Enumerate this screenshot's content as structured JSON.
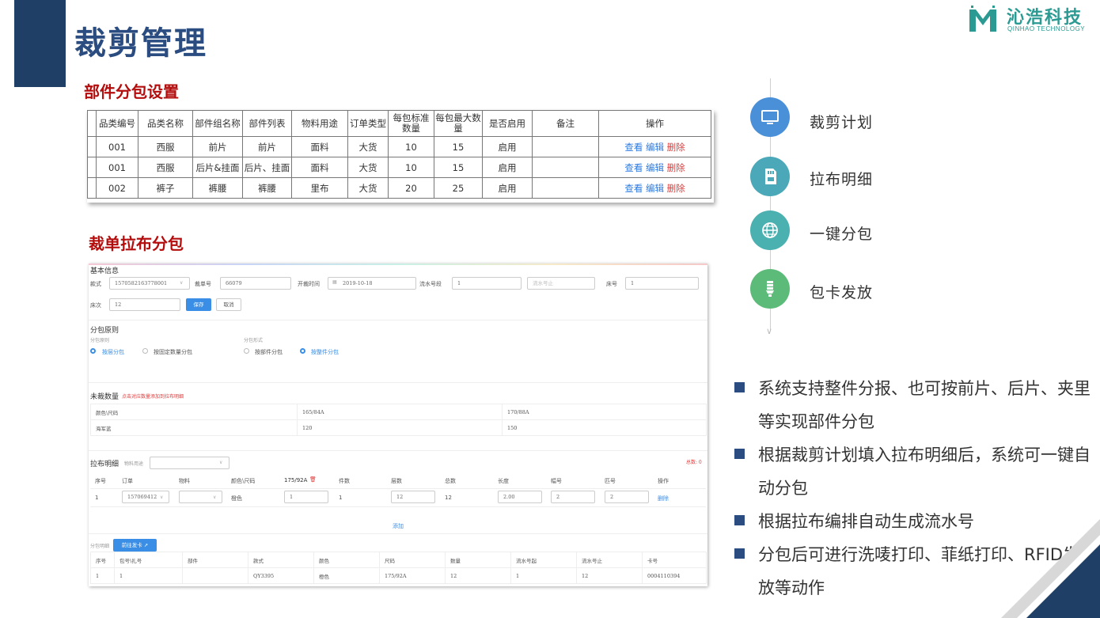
{
  "title": "裁剪管理",
  "logo": {
    "name": "沁浩科技",
    "sub": "QINHAO TECHNOLOGY"
  },
  "section1": {
    "title": "部件分包设置",
    "headers": [
      "品类编号",
      "品类名称",
      "部件组名称",
      "部件列表",
      "物料用途",
      "订单类型",
      "每包标准数量",
      "每包最大数量",
      "是否启用",
      "备注",
      "操作"
    ],
    "rows": [
      [
        "001",
        "西服",
        "前片",
        "前片",
        "面料",
        "大货",
        "10",
        "15",
        "启用",
        ""
      ],
      [
        "001",
        "西服",
        "后片&挂面",
        "后片、挂面",
        "面料",
        "大货",
        "10",
        "15",
        "启用",
        ""
      ],
      [
        "002",
        "裤子",
        "裤腰",
        "裤腰",
        "里布",
        "大货",
        "20",
        "25",
        "启用",
        ""
      ]
    ],
    "actions": {
      "view": "查看",
      "edit": "编辑",
      "delete": "删除"
    }
  },
  "section2": {
    "title": "裁单拉布分包",
    "basic": {
      "heading": "基本信息",
      "style_label": "款式",
      "style_value": "1570582163778001",
      "cut_no_label": "裁单号",
      "cut_no_value": "66079",
      "start_label": "开裁时间",
      "start_value": "2019-10-18",
      "serial_label": "流水号段",
      "serial_from": "1",
      "serial_to_placeholder": "流水号止",
      "bed_no_label": "床号",
      "bed_no_value": "1",
      "bed_times_label": "床次",
      "bed_times_value": "12",
      "save": "保存",
      "cancel": "取消"
    },
    "rule": {
      "heading": "分包原则",
      "rule_label": "分包原则",
      "opt_layer": "按层分包",
      "opt_fixed": "按固定数量分包",
      "form_label": "分包形式",
      "opt_part": "按部件分包",
      "opt_whole": "按整件分包"
    },
    "uncut": {
      "heading": "未裁数量",
      "hint": "点击对应数量添加到拉布明细",
      "col0": "颜色\\尺码",
      "col1": "165/84A",
      "col2": "170/88A",
      "row_label": "海军蓝",
      "val1": "120",
      "val2": "150"
    },
    "spread": {
      "heading": "拉布明细",
      "material_label": "物料用途",
      "total": "总数: 0",
      "headers": [
        "序号",
        "订单",
        "物料",
        "颜色\\尺码",
        "175/92A",
        "件数",
        "层数",
        "总数",
        "长度",
        "幅号",
        "匹号",
        "操作"
      ],
      "row": {
        "idx": "1",
        "order": "157069412",
        "color": "橙色",
        "size_val": "1",
        "pieces": "1",
        "layers": "12",
        "total": "12",
        "length": "2.00",
        "width_no": "2",
        "bolt_no": "2",
        "op": "删除"
      },
      "add": "添加"
    },
    "bundle": {
      "label": "分包明细",
      "btn": "前往发卡",
      "headers": [
        "序号",
        "包号\\扎号",
        "部件",
        "款式",
        "颜色",
        "尺码",
        "数量",
        "流水号起",
        "流水号止",
        "卡号"
      ],
      "row": [
        "1",
        "1",
        "",
        "QY3395",
        "橙色",
        "175/92A",
        "12",
        "1",
        "12",
        "0004110394"
      ]
    }
  },
  "flow": [
    "裁剪计划",
    "拉布明细",
    "一键分包",
    "包卡发放"
  ],
  "bullets": [
    "系统支持整件分报、也可按前片、后片、夹里等实现部件分包",
    "根据裁剪计划填入拉布明细后，系统可一键自动分包",
    "根据拉布编排自动生成流水号",
    "分包后可进行洗唛打印、菲纸打印、RFID发放等动作"
  ],
  "colors": {
    "title": "#2a4c80",
    "section": "#b30d0d",
    "teal": "#2b9a92",
    "flow1": "#4a90d9",
    "flow2": "#4aa8b8",
    "flow3": "#4ab0b0",
    "flow4": "#5dbb7a"
  }
}
